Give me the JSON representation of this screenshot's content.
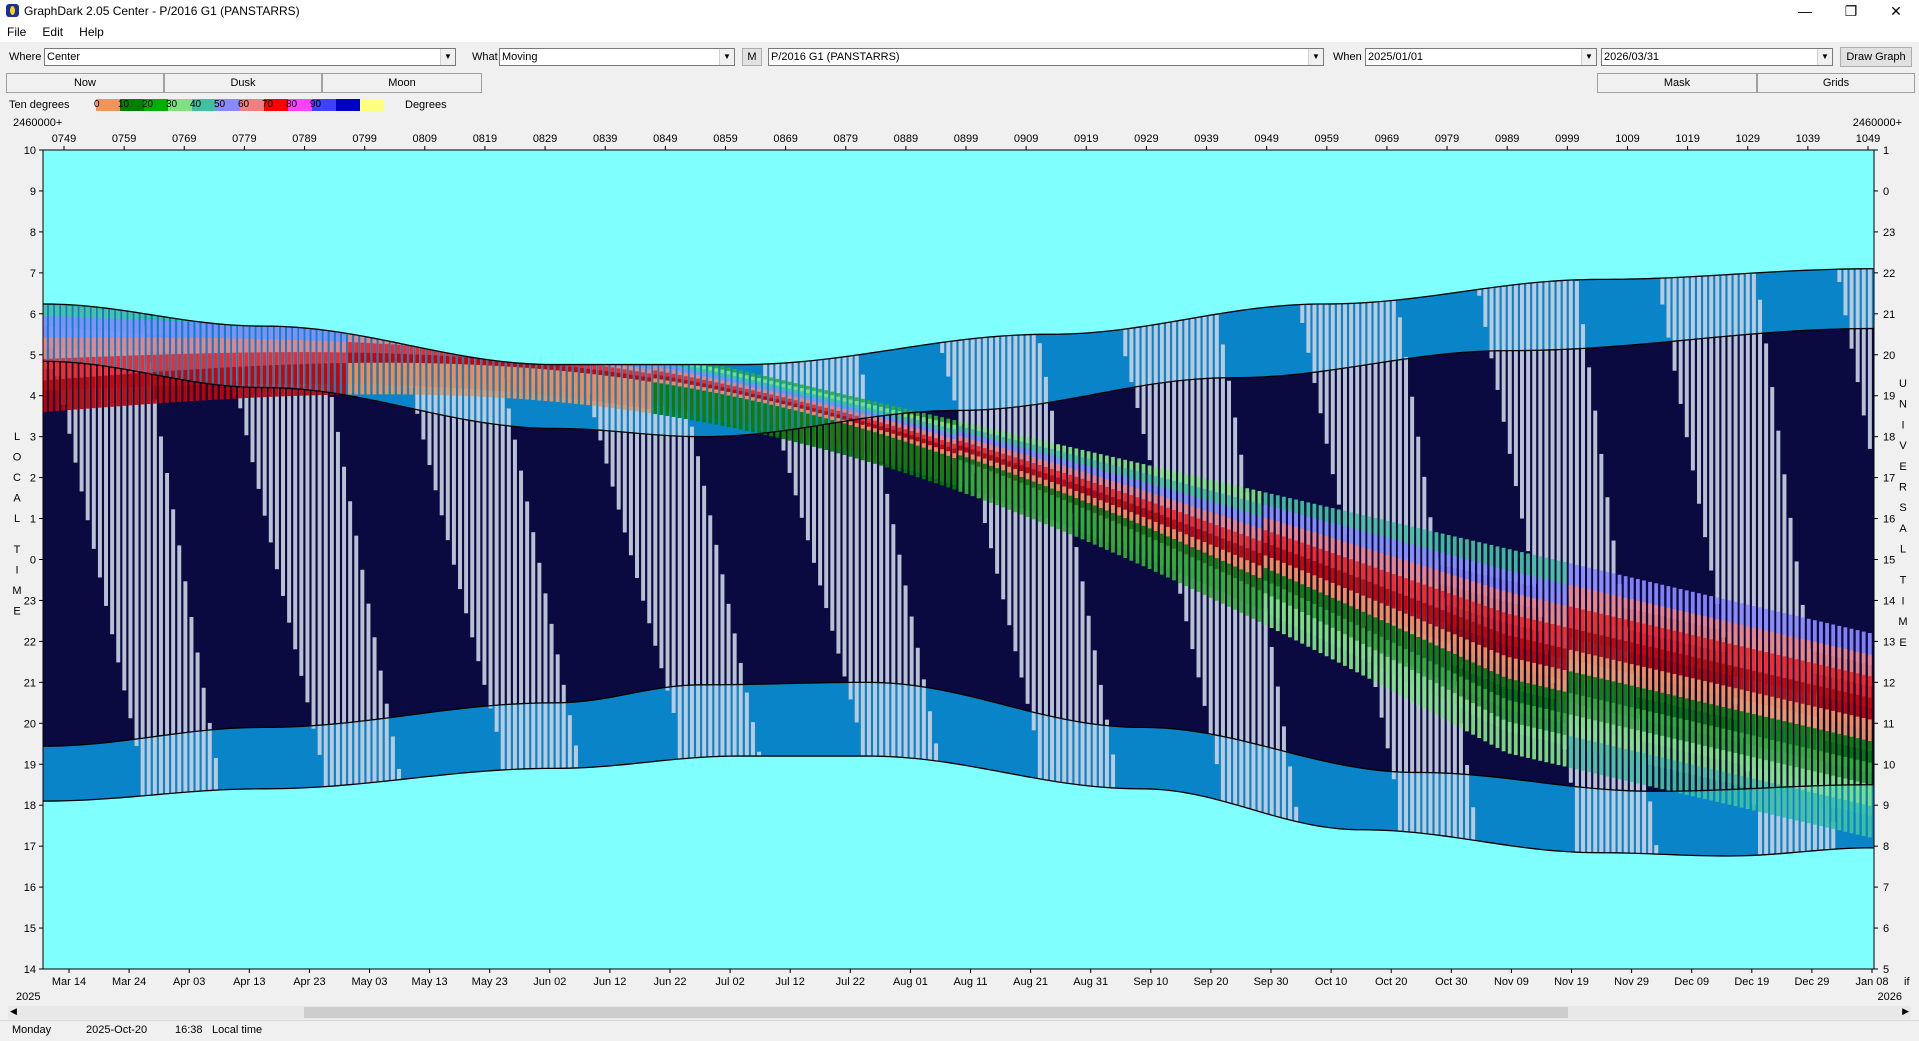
{
  "window": {
    "title": "GraphDark 2.05  Center  -  P/2016 G1 (PANSTARRS)",
    "minimize": "—",
    "maximize": "❐",
    "close": "✕"
  },
  "menu": [
    "File",
    "Edit",
    "Help"
  ],
  "toolbar": {
    "where_label": "Where",
    "where_value": "Center",
    "what_label": "What",
    "what_value": "Moving",
    "m_button": "M",
    "object_value": "P/2016 G1 (PANSTARRS)",
    "when_label": "When",
    "start_date": "2025/01/01",
    "end_date": "2026/03/31",
    "draw_button": "Draw Graph"
  },
  "buttons": {
    "now": "Now",
    "dusk": "Dusk",
    "moon": "Moon",
    "mask": "Mask",
    "grids": "Grids"
  },
  "legend": {
    "label": "Ten degrees",
    "suffix": "Degrees",
    "steps": [
      {
        "value": "0",
        "color": "#f0945a"
      },
      {
        "value": "10",
        "color": "#008000"
      },
      {
        "value": "20",
        "color": "#00b000"
      },
      {
        "value": "30",
        "color": "#80e080"
      },
      {
        "value": "40",
        "color": "#40c0a0"
      },
      {
        "value": "50",
        "color": "#8888ff"
      },
      {
        "value": "60",
        "color": "#f08080"
      },
      {
        "value": "70",
        "color": "#ff0000"
      },
      {
        "value": "80",
        "color": "#ff40ff"
      },
      {
        "value": "90",
        "color": "#4040ff"
      },
      {
        "value": "",
        "color": "#0000c0"
      },
      {
        "value": "",
        "color": "#ffff80"
      }
    ]
  },
  "chart_data": {
    "type": "heatmap",
    "top_axis_prefix_left": "2460000+",
    "top_axis_prefix_right": "2460000+",
    "top_ticks": [
      "0749",
      "0759",
      "0769",
      "0779",
      "0789",
      "0799",
      "0809",
      "0819",
      "0829",
      "0839",
      "0849",
      "0859",
      "0869",
      "0879",
      "0889",
      "0899",
      "0909",
      "0919",
      "0929",
      "0939",
      "0949",
      "0959",
      "0969",
      "0979",
      "0989",
      "0999",
      "1009",
      "1019",
      "1029",
      "1039",
      "1049"
    ],
    "bottom_ticks": [
      "Mar 14",
      "Mar 24",
      "Apr 03",
      "Apr 13",
      "Apr 23",
      "May 03",
      "May 13",
      "May 23",
      "Jun 02",
      "Jun 12",
      "Jun 22",
      "Jul 02",
      "Jul 12",
      "Jul 22",
      "Aug 01",
      "Aug 11",
      "Aug 21",
      "Aug 31",
      "Sep 10",
      "Sep 20",
      "Sep 30",
      "Oct 10",
      "Oct 20",
      "Oct 30",
      "Nov 09",
      "Nov 19",
      "Nov 29",
      "Dec 09",
      "Dec 19",
      "Dec 29",
      "Jan 08"
    ],
    "bottom_year_left": "2025",
    "bottom_year_right": "2026",
    "bottom_right_extra": "if",
    "left_axis_label": "LOCAL TIME",
    "left_ticks": [
      "10",
      "9",
      "8",
      "7",
      "6",
      "5",
      "4",
      "3",
      "2",
      "1",
      "0",
      "23",
      "22",
      "21",
      "20",
      "19",
      "18",
      "17",
      "16",
      "15",
      "14"
    ],
    "right_axis_label": "UNIVERSAL TIME",
    "right_ticks": [
      "1",
      "0",
      "23",
      "22",
      "21",
      "20",
      "19",
      "18",
      "17",
      "16",
      "15",
      "14",
      "13",
      "12",
      "11",
      "10",
      "9",
      "8",
      "7",
      "6",
      "5"
    ],
    "colors": {
      "day": "#80ffff",
      "twilight": "#0a84c8",
      "night": "#0a0a40",
      "moonlit": "#c8d0e0",
      "alt_bands": [
        "#f0945a",
        "#008000",
        "#30b030",
        "#80e080",
        "#40c0a0",
        "#8888ff",
        "#f08080",
        "#ff2020",
        "#cc0000"
      ]
    }
  },
  "status": {
    "day": "Monday",
    "date": "2025-Oct-20",
    "time": "16:38",
    "mode": "Local time"
  }
}
